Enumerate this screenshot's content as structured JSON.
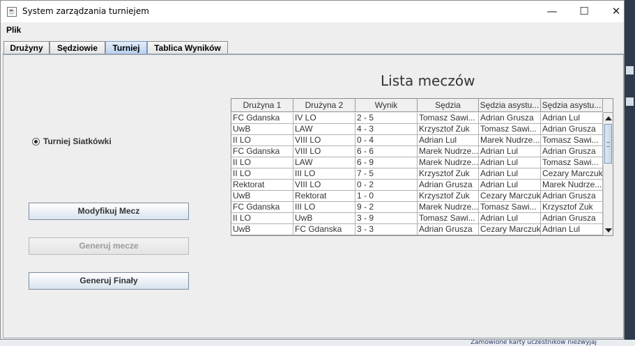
{
  "window": {
    "title": "System zarządzania turniejem",
    "icon": "java-cup-icon"
  },
  "window_controls": {
    "minimize": "—",
    "maximize": "☐",
    "close": "✕"
  },
  "menu": {
    "file": "Plik"
  },
  "tabs": [
    {
      "label": "Drużyny",
      "active": false
    },
    {
      "label": "Sędziowie",
      "active": false
    },
    {
      "label": "Turniej",
      "active": true
    },
    {
      "label": "Tablica Wyników",
      "active": false
    }
  ],
  "tournament": {
    "radio_label": "Turniej Siatkówki",
    "radio_selected": true
  },
  "buttons": {
    "modify": "Modyfikuj Mecz",
    "generate": "Generuj mecze",
    "generate_enabled": false,
    "finals": "Generuj Finały"
  },
  "matches": {
    "title": "Lista meczów",
    "columns": [
      "Drużyna 1",
      "Drużyna 2",
      "Wynik",
      "Sędzia",
      "Sędzia asystu...",
      "Sędzia asystu..."
    ],
    "rows": [
      [
        "FC Gdanska",
        "IV LO",
        "2 - 5",
        "Tomasz Sawi...",
        "Adrian Grusza",
        "Adrian Lul"
      ],
      [
        "UwB",
        "LAW",
        "4 - 3",
        "Krzysztof Zuk",
        "Tomasz Sawi...",
        "Adrian Grusza"
      ],
      [
        "II LO",
        "VIII LO",
        "0 - 4",
        "Adrian Lul",
        "Marek Nudrze...",
        "Tomasz Sawi..."
      ],
      [
        "FC Gdanska",
        "VIII LO",
        "6 - 6",
        "Marek Nudrze...",
        "Adrian Lul",
        "Adrian Grusza"
      ],
      [
        "II LO",
        "LAW",
        "6 - 9",
        "Marek Nudrze...",
        "Adrian Lul",
        "Tomasz Sawi..."
      ],
      [
        "II LO",
        "III LO",
        "7 - 5",
        "Krzysztof Zuk",
        "Adrian Lul",
        "Cezary Marczuk"
      ],
      [
        "Rektorat",
        "VIII LO",
        "0 - 2",
        "Adrian Grusza",
        "Adrian Lul",
        "Marek Nudrze..."
      ],
      [
        "UwB",
        "Rektorat",
        "1 - 0",
        "Krzysztof Zuk",
        "Cezary Marczuk",
        "Adrian Grusza"
      ],
      [
        "FC Gdanska",
        "III LO",
        "9 - 2",
        "Marek Nudrze...",
        "Tomasz Sawi...",
        "Krzysztof Zuk"
      ],
      [
        "II LO",
        "UwB",
        "3 - 9",
        "Tomasz Sawi...",
        "Adrian Lul",
        "Adrian Grusza"
      ],
      [
        "UwB",
        "FC Gdanska",
        "3 - 3",
        "Adrian Grusza",
        "Cezary Marczuk",
        "Adrian Lul"
      ]
    ]
  },
  "background": {
    "behind_text": "Zamowione karty uczestnikow niezwyjaj"
  }
}
